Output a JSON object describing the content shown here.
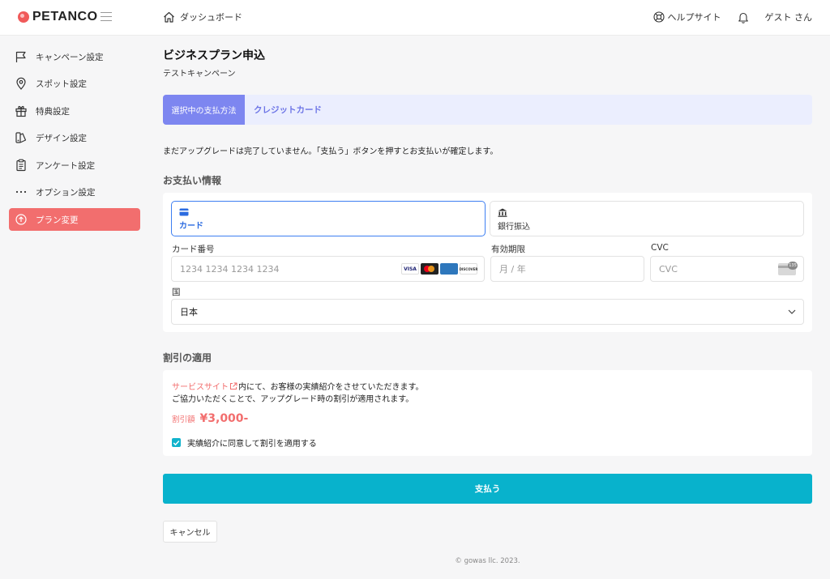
{
  "header": {
    "logo_text": "PETANCO",
    "breadcrumb": "ダッシュボード",
    "help_label": "ヘルプサイト",
    "user_label": "ゲスト さん"
  },
  "sidebar": {
    "items": [
      {
        "label": "キャンペーン設定",
        "icon": "flag-icon"
      },
      {
        "label": "スポット設定",
        "icon": "map-pin-icon"
      },
      {
        "label": "特典設定",
        "icon": "gift-icon"
      },
      {
        "label": "デザイン設定",
        "icon": "palette-icon"
      },
      {
        "label": "アンケート設定",
        "icon": "clipboard-icon"
      },
      {
        "label": "オプション設定",
        "icon": "more-dots-icon"
      },
      {
        "label": "プラン変更",
        "icon": "arrow-up-circle-icon",
        "active": true
      }
    ]
  },
  "page": {
    "title": "ビジネスプラン申込",
    "subtitle": "テストキャンペーン"
  },
  "payment_method": {
    "label": "選択中の支払方法",
    "value": "クレジットカード"
  },
  "notice": "まだアップグレードは完了していません。「支払う」ボタンを押すとお支払いが確定します。",
  "payment_info": {
    "title": "お支払い情報",
    "tabs": [
      {
        "label": "カード",
        "icon": "credit-card-icon",
        "selected": true
      },
      {
        "label": "銀行振込",
        "icon": "bank-icon",
        "selected": false
      }
    ],
    "card_number_label": "カード番号",
    "card_number_placeholder": "1234 1234 1234 1234",
    "brands": [
      "VISA",
      "MC",
      "AMEX",
      "DISCOVER"
    ],
    "expiry_label": "有効期限",
    "expiry_placeholder": "月 / 年",
    "cvc_label": "CVC",
    "cvc_placeholder": "CVC",
    "cvc_badge": "135",
    "country_label": "国",
    "country_value": "日本"
  },
  "discount": {
    "title": "割引の適用",
    "link_text": "サービスサイト",
    "line1_rest": "内にて、お客様の実績紹介をさせていただきます。",
    "line2": "ご協力いただくことで、アップグレード時の割引が適用されます。",
    "amount_label": "割引額",
    "amount_value": "¥3,000-",
    "consent_label": "実績紹介に同意して割引を適用する",
    "consent_checked": true
  },
  "actions": {
    "pay_label": "支払う",
    "cancel_label": "キャンセル"
  },
  "footer": "© gowas llc. 2023.",
  "colors": {
    "brand": "#f05a5a",
    "accent": "#08b2cc",
    "method_label_bg": "#7d86f0",
    "selected_border": "#3e7ff2"
  }
}
